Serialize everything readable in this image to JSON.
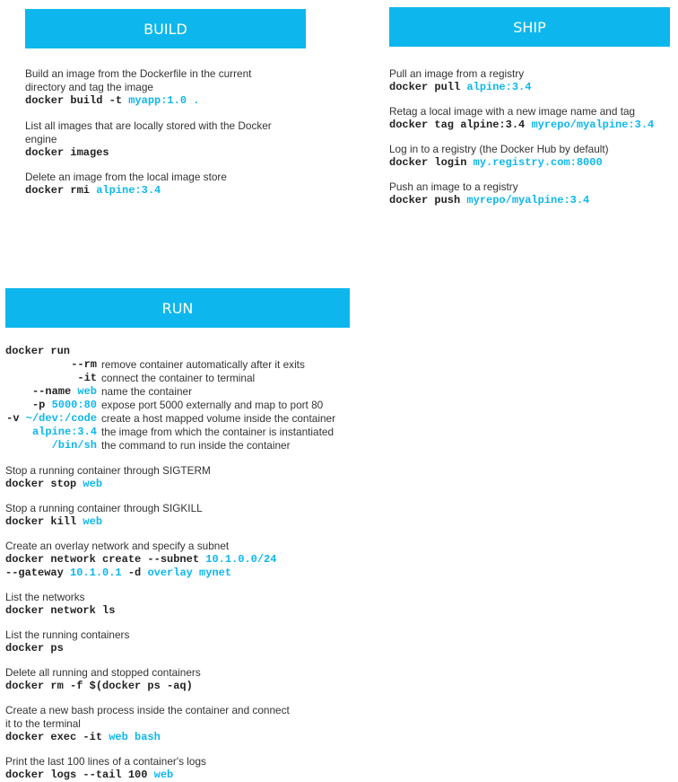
{
  "build": {
    "title": "BUILD",
    "items": [
      {
        "desc": "Build an image from the Dockerfile in the current",
        "desc2": "directory and tag the image",
        "cmd": "docker build -t ",
        "arg": "myapp:1.0 ."
      },
      {
        "desc": "List all images that are locally stored with the Docker",
        "desc2": "engine",
        "cmd": "docker images",
        "arg": ""
      },
      {
        "desc": "Delete an image from the local image store",
        "cmd": "docker rmi ",
        "arg": "alpine:3.4"
      }
    ]
  },
  "ship": {
    "title": "SHIP",
    "items": [
      {
        "desc": "Pull an image from a registry",
        "cmd": "docker pull ",
        "arg": "alpine:3.4"
      },
      {
        "desc": "Retag a local image with a new image name and tag",
        "cmd": "docker tag alpine:3.4 ",
        "arg": "myrepo/myalpine:3.4"
      },
      {
        "desc": "Log in to a registry (the Docker Hub by default)",
        "cmd": "docker login ",
        "arg": "my.registry.com:8000"
      },
      {
        "desc": "Push an image to a registry",
        "cmd": "docker push ",
        "arg": "myrepo/myalpine:3.4"
      }
    ]
  },
  "run": {
    "title": "RUN",
    "docker_run": "docker run",
    "options": [
      {
        "flag": "--rm",
        "flag_hl": "",
        "desc": "remove container automatically after it exits"
      },
      {
        "flag": "-it",
        "flag_hl": "",
        "desc": "connect the container to terminal"
      },
      {
        "flag": "--name ",
        "flag_hl": "web",
        "desc": "name the container"
      },
      {
        "flag": "-p ",
        "flag_hl": "5000:80",
        "desc": "expose port 5000 externally and map to port 80"
      },
      {
        "flag": "-v ",
        "flag_hl": "~/dev:/code",
        "desc": "create a host mapped volume inside the container"
      },
      {
        "flag": "",
        "flag_hl": "alpine:3.4",
        "desc": "the image from which the container is instantiated"
      },
      {
        "flag": "",
        "flag_hl": "/bin/sh",
        "desc": "the command to run inside the container"
      }
    ],
    "items": [
      {
        "desc": "Stop a running container through SIGTERM",
        "lines": [
          [
            {
              "t": "docker stop ",
              "h": false
            },
            {
              "t": "web",
              "h": true
            }
          ]
        ]
      },
      {
        "desc": "Stop a running container through SIGKILL",
        "lines": [
          [
            {
              "t": "docker kill ",
              "h": false
            },
            {
              "t": "web",
              "h": true
            }
          ]
        ]
      },
      {
        "desc": "Create an overlay network and specify a subnet",
        "lines": [
          [
            {
              "t": "docker network create --subnet ",
              "h": false
            },
            {
              "t": "10.1.0.0/24",
              "h": true
            }
          ],
          [
            {
              "t": "--gateway ",
              "h": false
            },
            {
              "t": "10.1.0.1",
              "h": true
            },
            {
              "t": " -d ",
              "h": false
            },
            {
              "t": "overlay mynet",
              "h": true
            }
          ]
        ]
      },
      {
        "desc": "List the networks",
        "lines": [
          [
            {
              "t": "docker network ls",
              "h": false
            }
          ]
        ]
      },
      {
        "desc": "List the running containers",
        "lines": [
          [
            {
              "t": "docker ps",
              "h": false
            }
          ]
        ]
      },
      {
        "desc": "Delete all running and stopped containers",
        "lines": [
          [
            {
              "t": "docker rm -f $(docker ps -aq)",
              "h": false
            }
          ]
        ]
      },
      {
        "desc": "Create a new bash process inside the container and connect",
        "desc2": "it to the terminal",
        "lines": [
          [
            {
              "t": "docker exec -it ",
              "h": false
            },
            {
              "t": "web bash",
              "h": true
            }
          ]
        ]
      },
      {
        "desc": "Print the last 100 lines of a container's logs",
        "lines": [
          [
            {
              "t": "docker logs --tail 100 ",
              "h": false
            },
            {
              "t": "web",
              "h": true
            }
          ]
        ]
      }
    ]
  },
  "colors": {
    "accent": "#0db7ed",
    "text": "#333333"
  }
}
